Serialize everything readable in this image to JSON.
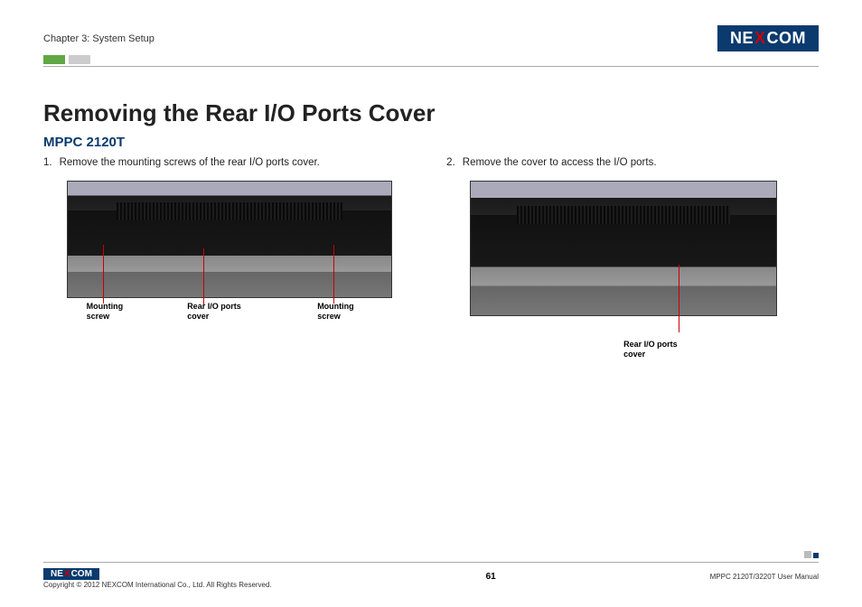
{
  "header": {
    "chapter": "Chapter 3: System Setup",
    "brand": {
      "pre": "NE",
      "x": "X",
      "post": "COM"
    }
  },
  "main": {
    "title": "Removing the Rear I/O Ports Cover",
    "subtitle": "MPPC 2120T",
    "steps": [
      {
        "num": "1.",
        "text": "Remove the mounting screws of the rear I/O ports cover.",
        "labels": {
          "left": "Mounting\nscrew",
          "center": "Rear I/O ports\ncover",
          "right": "Mounting\nscrew"
        }
      },
      {
        "num": "2.",
        "text": "Remove the cover to access the I/O ports.",
        "labels": {
          "center": "Rear I/O ports\ncover"
        }
      }
    ]
  },
  "footer": {
    "brand": {
      "pre": "NE",
      "x": "X",
      "post": "COM"
    },
    "copyright": "Copyright © 2012 NEXCOM International Co., Ltd. All Rights Reserved.",
    "page": "61",
    "manual": "MPPC 2120T/3220T User Manual"
  }
}
